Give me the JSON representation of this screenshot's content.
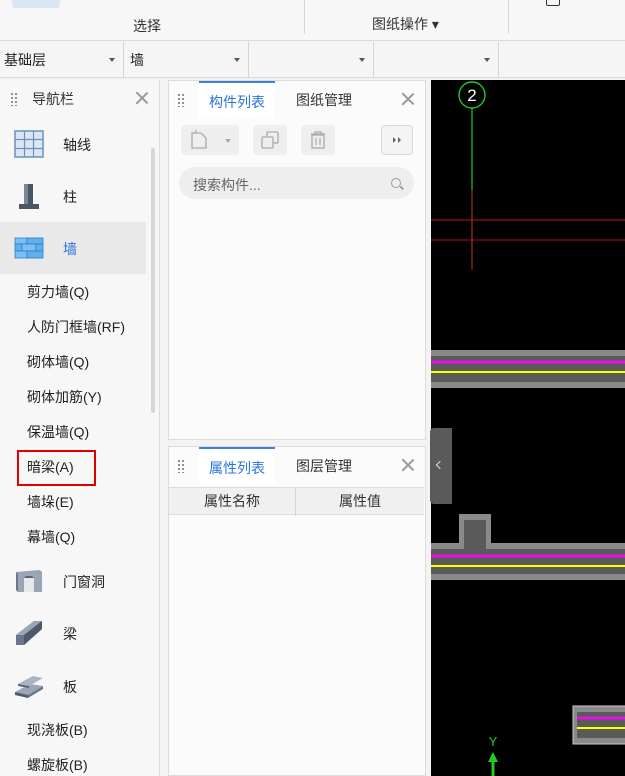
{
  "ribbon": {
    "select_group": "选择",
    "drawing_group": "图纸操作 ▾"
  },
  "selectors": {
    "floor": "基础层",
    "type": "墙",
    "empty_1": "",
    "empty_2": ""
  },
  "nav": {
    "title": "导航栏",
    "categories": [
      {
        "label": "轴线",
        "icon": "grid-icon"
      },
      {
        "label": "柱",
        "icon": "column-icon"
      },
      {
        "label": "墙",
        "icon": "brick-wall-icon"
      },
      {
        "label": "门窗洞",
        "icon": "door-window-icon"
      },
      {
        "label": "梁",
        "icon": "beam-icon"
      },
      {
        "label": "板",
        "icon": "slab-icon"
      }
    ],
    "wall_items": [
      "剪力墙(Q)",
      "人防门框墙(RF)",
      "砌体墙(Q)",
      "砌体加筋(Y)",
      "保温墙(Q)",
      "暗梁(A)",
      "墙垛(E)",
      "幕墙(Q)"
    ],
    "slab_items": [
      "现浇板(B)",
      "螺旋板(B)"
    ],
    "selected_item": "暗梁(A)"
  },
  "component_panel": {
    "tabs": [
      "构件列表",
      "图纸管理"
    ],
    "active_tab": "构件列表",
    "search_placeholder": "搜索构件..."
  },
  "property_panel": {
    "tabs": [
      "属性列表",
      "图层管理"
    ],
    "active_tab": "属性列表",
    "columns": [
      "属性名称",
      "属性值"
    ]
  },
  "canvas": {
    "axis_label": "2",
    "y_axis_label": "Y"
  },
  "colors": {
    "accent": "#2b74d8",
    "highlight_border": "#e00000",
    "canvas_bg": "#000000",
    "axis_green": "#22cc22",
    "crosshair_red": "#c0101f",
    "wall_magenta": "#ff00ff",
    "wall_yellow": "#ffff00"
  }
}
